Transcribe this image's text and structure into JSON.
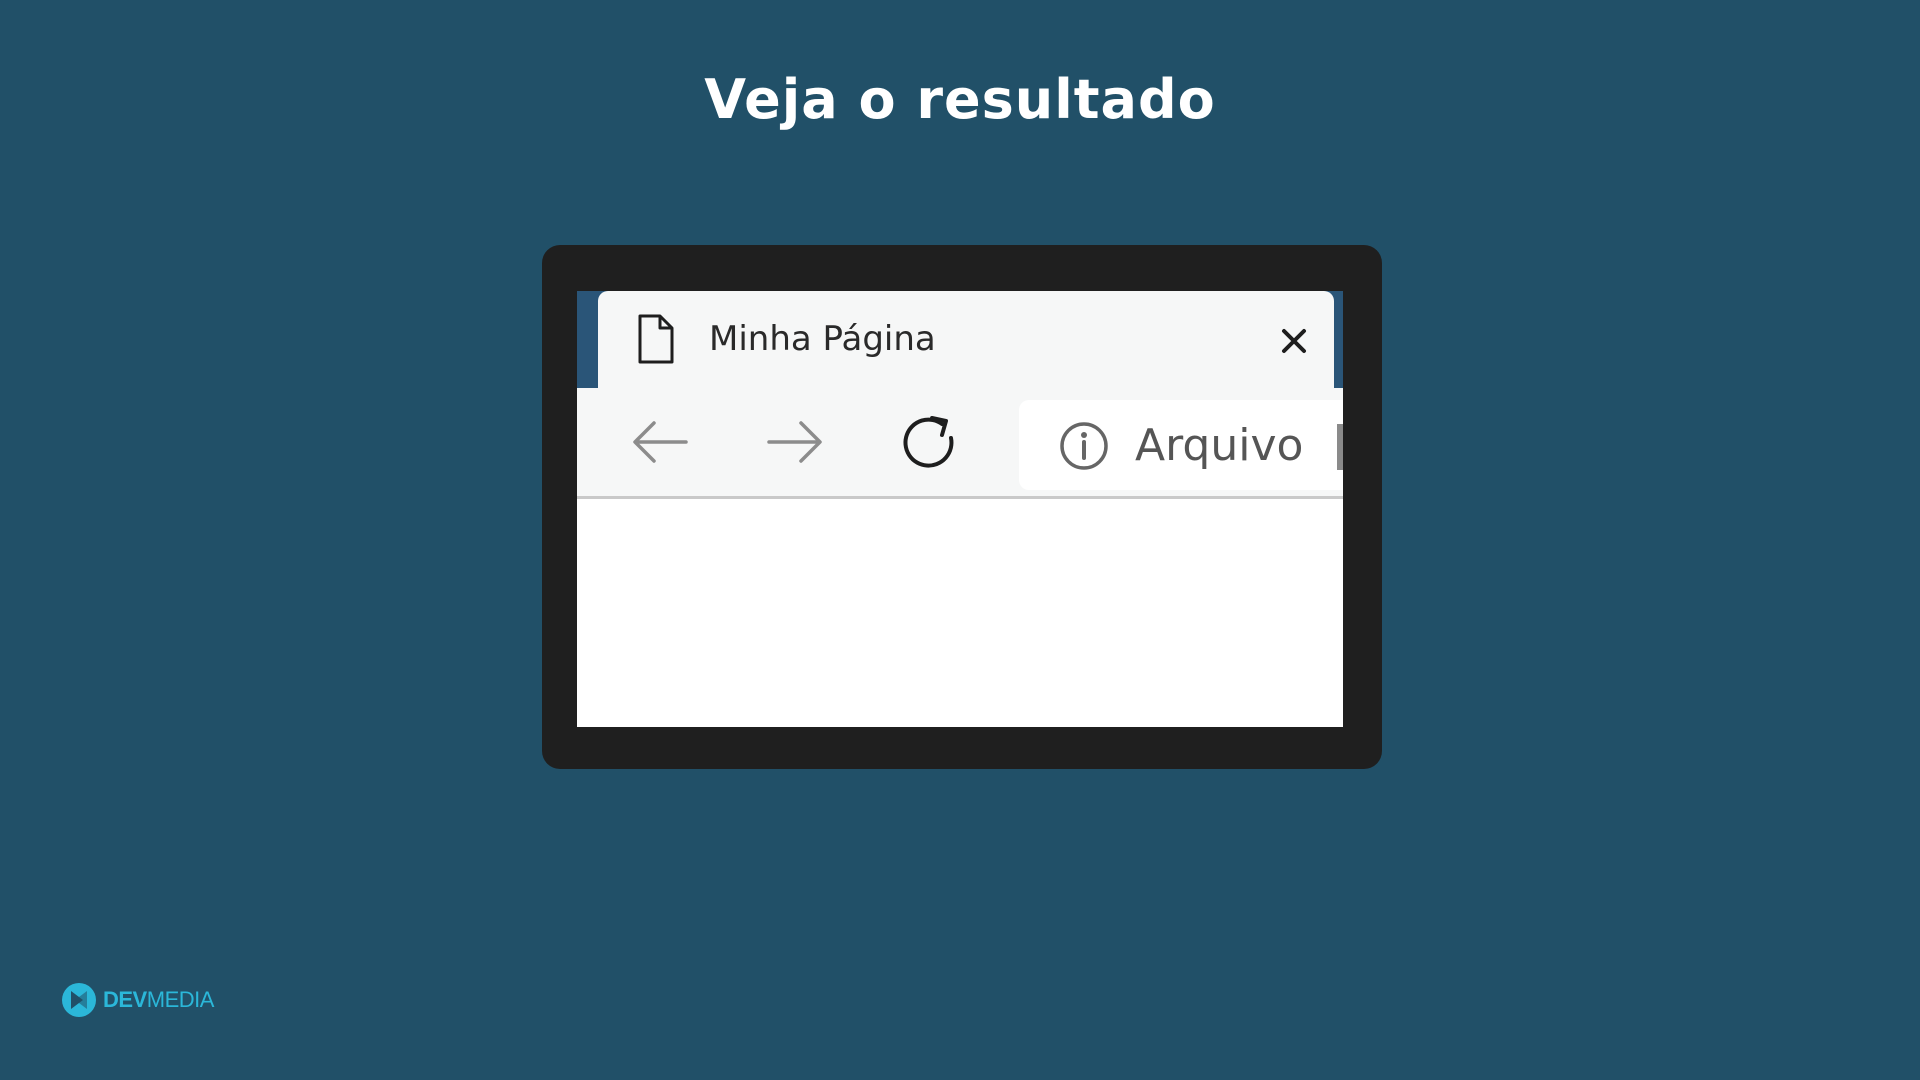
{
  "slide": {
    "title": "Veja o resultado"
  },
  "browser": {
    "tab": {
      "icon": "document-icon",
      "title": "Minha Página",
      "close_icon": "close-icon"
    },
    "toolbar": {
      "back_icon": "arrow-left-icon",
      "forward_icon": "arrow-right-icon",
      "reload_icon": "reload-icon"
    },
    "address_bar": {
      "icon": "info-icon",
      "text": "Arquivo"
    }
  },
  "brand": {
    "logo_icon": "devmedia-logo-icon",
    "name_bold": "DEV",
    "name_regular": "MEDIA",
    "color": "#2bb7d9"
  },
  "colors": {
    "background": "#215068",
    "frame": "#1f1f1f",
    "tab_strip": "#2a5578",
    "toolbar": "#f6f7f7"
  }
}
